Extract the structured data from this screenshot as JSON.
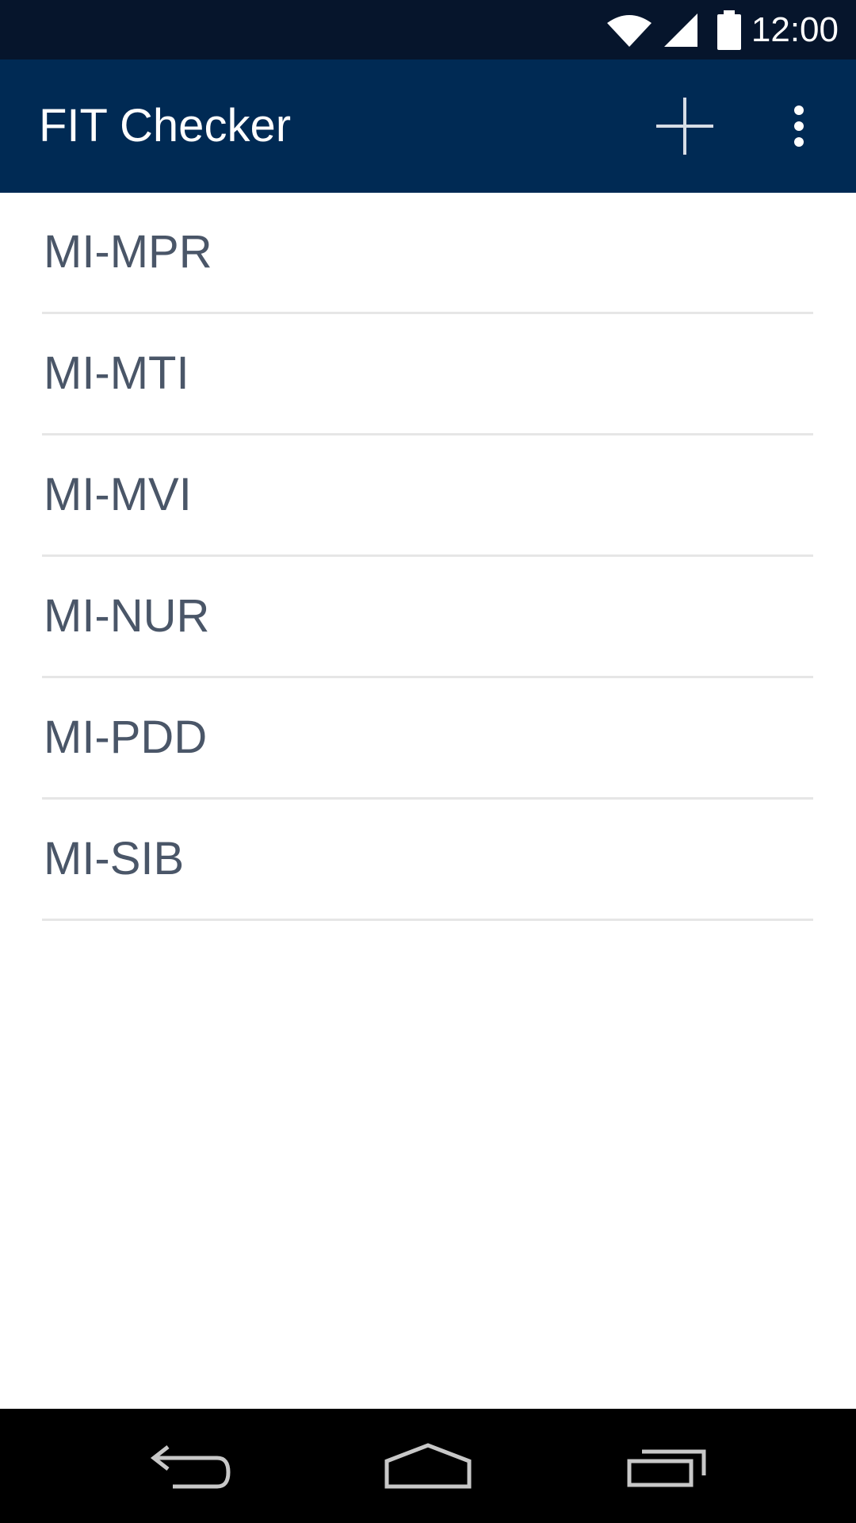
{
  "status_bar": {
    "time": "12:00",
    "icons": [
      "wifi-icon",
      "signal-icon",
      "battery-icon"
    ]
  },
  "app_bar": {
    "title": "FIT Checker",
    "actions": [
      "add-icon",
      "overflow-menu-icon"
    ]
  },
  "list": {
    "items": [
      {
        "label": "MI-MPR"
      },
      {
        "label": "MI-MTI"
      },
      {
        "label": "MI-MVI"
      },
      {
        "label": "MI-NUR"
      },
      {
        "label": "MI-PDD"
      },
      {
        "label": "MI-SIB"
      }
    ]
  },
  "nav_bar": {
    "buttons": [
      "back-icon",
      "home-icon",
      "recents-icon"
    ]
  },
  "colors": {
    "status_bar": "#06152c",
    "app_bar": "#002a54",
    "list_text": "#4a5668",
    "divider": "#e6e6e6",
    "nav_bar": "#000000"
  }
}
